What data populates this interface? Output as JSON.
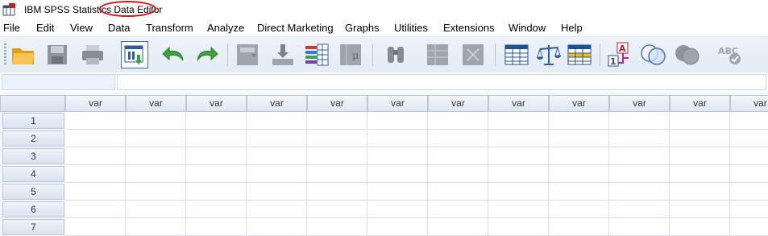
{
  "window": {
    "title_prefix": "IBM SPSS Statistics ",
    "title_highlight": "Data Editor"
  },
  "menu": [
    {
      "label": "File"
    },
    {
      "label": "Edit"
    },
    {
      "label": "View"
    },
    {
      "label": "Data"
    },
    {
      "label": "Transform"
    },
    {
      "label": "Analyze"
    },
    {
      "label": "Direct Marketing"
    },
    {
      "label": "Graphs"
    },
    {
      "label": "Utilities"
    },
    {
      "label": "Extensions"
    },
    {
      "label": "Window"
    },
    {
      "label": "Help"
    }
  ],
  "toolbar": [
    {
      "icon": "open-folder-icon"
    },
    {
      "icon": "save-icon"
    },
    {
      "icon": "print-icon"
    },
    {
      "icon": "recall-dialog-icon"
    },
    {
      "icon": "undo-icon"
    },
    {
      "icon": "redo-icon"
    },
    {
      "icon": "goto-case-icon"
    },
    {
      "icon": "goto-variable-icon"
    },
    {
      "icon": "variables-icon"
    },
    {
      "icon": "run-descriptives-icon"
    },
    {
      "icon": "find-icon"
    },
    {
      "icon": "insert-cases-icon"
    },
    {
      "icon": "insert-variable-icon"
    },
    {
      "icon": "split-file-icon"
    },
    {
      "icon": "weight-cases-icon"
    },
    {
      "icon": "select-cases-icon"
    },
    {
      "icon": "value-labels-icon"
    },
    {
      "icon": "use-variable-sets-icon"
    },
    {
      "icon": "show-all-variables-icon"
    },
    {
      "icon": "spell-check-icon"
    }
  ],
  "grid": {
    "column_header": "var",
    "columns": 12,
    "rows": [
      "1",
      "2",
      "3",
      "4",
      "5",
      "6",
      "7"
    ]
  },
  "colors": {
    "highlight_ellipse": "#dd1111",
    "header_bg": "#dde6f0",
    "grid_line": "#d6dfe9"
  }
}
